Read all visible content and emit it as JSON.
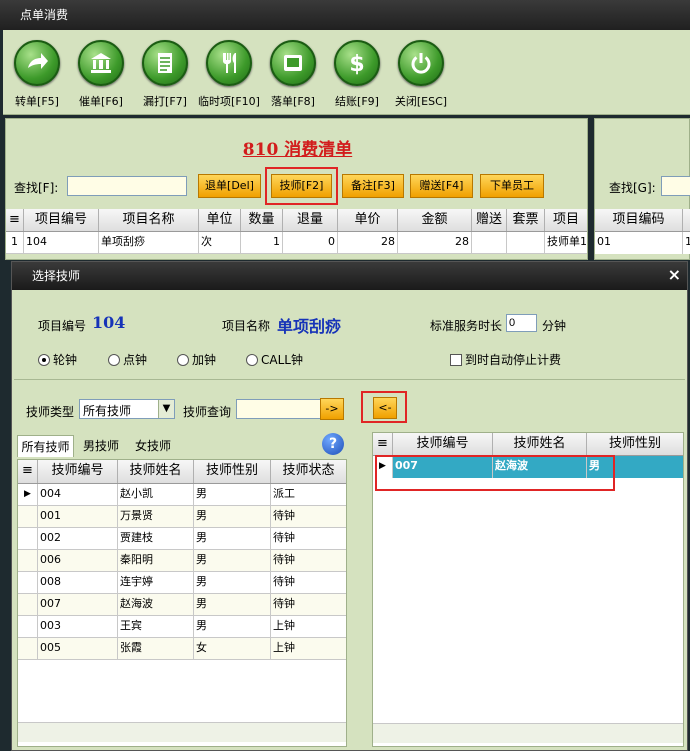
{
  "window": {
    "title": "点单消费"
  },
  "toolbar": [
    {
      "label": "转单[F5]",
      "icon": "arrow-right-icon"
    },
    {
      "label": "催单[F6]",
      "icon": "bank-icon"
    },
    {
      "label": "漏打[F7]",
      "icon": "document-icon"
    },
    {
      "label": "临时项[F10]",
      "icon": "utensils-icon"
    },
    {
      "label": "落单[F8]",
      "icon": "clipboard-icon"
    },
    {
      "label": "结账[F9]",
      "icon": "dollar-icon"
    },
    {
      "label": "关闭[ESC]",
      "icon": "power-icon"
    }
  ],
  "order": {
    "title": "810 消费清单",
    "search_label": "查找[F]:",
    "search_value": "",
    "buttons": [
      "退单[Del]",
      "技师[F2]",
      "备注[F3]",
      "赠送[F4]",
      "下单员工"
    ],
    "columns": [
      "项目编号",
      "项目名称",
      "单位",
      "数量",
      "退量",
      "单价",
      "金额",
      "赠送",
      "套票",
      "项目"
    ],
    "rows": [
      {
        "idx": "1",
        "code": "104",
        "name": "单项刮痧",
        "unit": "次",
        "qty": "1",
        "ret": "0",
        "price": "28",
        "amount": "28",
        "gift": "",
        "ticket": "",
        "item": "技师单1"
      }
    ]
  },
  "right_panel": {
    "search_label": "查找[G]:",
    "column": "项目编码",
    "row": "01",
    "row_extra": "1"
  },
  "dialog": {
    "title": "选择技师",
    "close": "×",
    "item_code_label": "项目编号",
    "item_code": "104",
    "item_name_label": "项目名称",
    "item_name": "单项刮痧",
    "duration_label": "标准服务时长",
    "duration_value": "0",
    "duration_unit": "分钟",
    "radios": [
      "轮钟",
      "点钟",
      "加钟",
      "CALL钟"
    ],
    "radio_selected": "轮钟",
    "auto_stop_label": "到时自动停止计费",
    "tech_type_label": "技师类型",
    "tech_type_value": "所有技师",
    "tech_query_label": "技师查询",
    "tech_query_value": "",
    "go_button": "->",
    "back_button": "<-",
    "tabs": [
      "所有技师",
      "男技师",
      "女技师"
    ],
    "help_icon": "question-icon",
    "left_columns": [
      "技师编号",
      "技师姓名",
      "技师性别",
      "技师状态"
    ],
    "left_rows": [
      {
        "no": "004",
        "name": "赵小凯",
        "sex": "男",
        "status": "派工"
      },
      {
        "no": "001",
        "name": "万景贤",
        "sex": "男",
        "status": "待钟"
      },
      {
        "no": "002",
        "name": "贾建枝",
        "sex": "男",
        "status": "待钟"
      },
      {
        "no": "006",
        "name": "秦阳明",
        "sex": "男",
        "status": "待钟"
      },
      {
        "no": "008",
        "name": "连宇婷",
        "sex": "男",
        "status": "待钟"
      },
      {
        "no": "007",
        "name": "赵海波",
        "sex": "男",
        "status": "待钟"
      },
      {
        "no": "003",
        "name": "王宾",
        "sex": "男",
        "status": "上钟"
      },
      {
        "no": "005",
        "name": "张霞",
        "sex": "女",
        "status": "上钟"
      }
    ],
    "right_columns": [
      "技师编号",
      "技师姓名",
      "技师性别"
    ],
    "right_rows": [
      {
        "no": "007",
        "name": "赵海波",
        "sex": "男"
      }
    ]
  },
  "colors": {
    "panel": "#d5e2bf",
    "highlight": "#e02525",
    "selected_row": "#33a9c4",
    "title": "#d21c1c",
    "value_blue": "#1633b8"
  }
}
